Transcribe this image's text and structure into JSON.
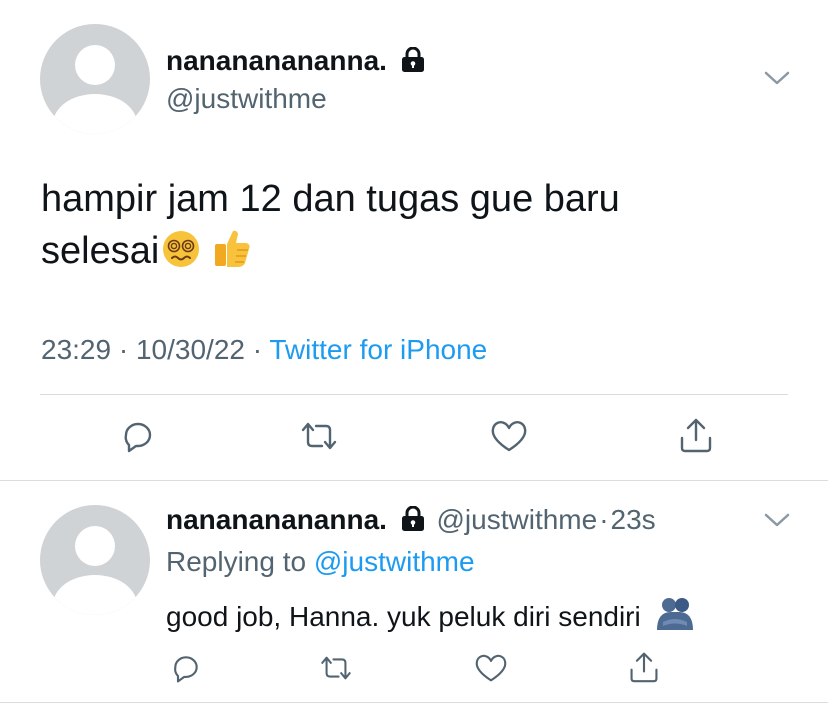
{
  "main_tweet": {
    "display_name": "nanananananna.",
    "handle": "@justwithme",
    "text_line1": "hampir jam 12 dan tugas gue baru",
    "text_line2": "selesai",
    "time": "23:29",
    "date": "10/30/22",
    "separator": "·",
    "source": "Twitter for iPhone",
    "icons": [
      "lock-icon",
      "chevron-down-icon",
      "reply-icon",
      "retweet-icon",
      "like-icon",
      "share-icon"
    ],
    "emojis": [
      "face-with-spiral-eyes",
      "thumbs-up"
    ]
  },
  "reply_tweet": {
    "display_name": "nanananananna.",
    "handle": "@justwithme",
    "separator": "·",
    "age": "23s",
    "replying_prefix": "Replying to",
    "replying_handle": "@justwithme",
    "text": "good job, Hanna. yuk peluk diri sendiri",
    "icons": [
      "lock-icon",
      "chevron-down-icon",
      "reply-icon",
      "retweet-icon",
      "like-icon",
      "share-icon"
    ],
    "emojis": [
      "people-hugging"
    ]
  },
  "colors": {
    "text": "#0f1419",
    "secondary": "#536471",
    "link": "#1d9bf0",
    "avatar_bg": "#cfd3d6",
    "divider": "#d7dde1"
  }
}
